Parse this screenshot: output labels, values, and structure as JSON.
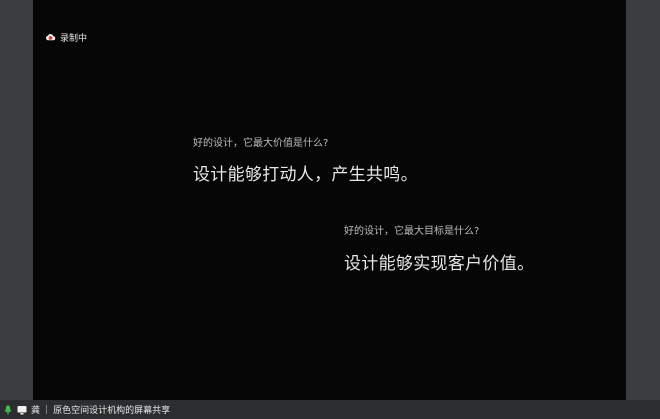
{
  "recording": {
    "label": "录制中",
    "icon": "cloud-record-icon"
  },
  "slide": {
    "question_1": "好的设计，它最大价值是什么?",
    "answer_1": "设计能够打动人，产生共鸣。",
    "question_2": "好的设计，它最大目标是什么?",
    "answer_2": "设计能够实现客户价值。"
  },
  "status_bar": {
    "mic_icon": "microphone-icon",
    "screen_icon": "screen-share-icon",
    "user": "龚",
    "separator": "|",
    "share_text": "原色空间设计机构的屏幕共享"
  },
  "colors": {
    "background": "#060607",
    "accent_mic": "#3bbf4f",
    "record_red": "#e23a3a"
  }
}
